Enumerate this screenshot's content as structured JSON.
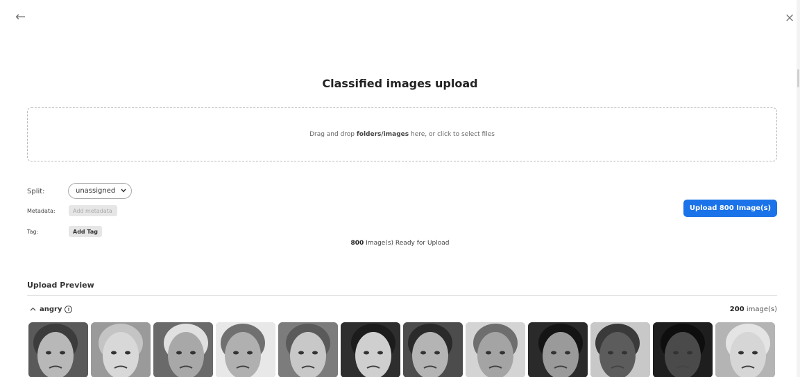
{
  "nav": {
    "back": "←",
    "close": "×"
  },
  "title": "Classified images upload",
  "dropzone": {
    "prefix": "Drag and drop ",
    "bold": "folders/images",
    "suffix": " here, or click to select files"
  },
  "form": {
    "split_label": "Split:",
    "split_value": "unassigned",
    "metadata_label": "Metadata:",
    "metadata_button": "Add metadata",
    "tag_label": "Tag:",
    "tag_button": "Add Tag"
  },
  "upload_button": "Upload 800 Image(s)",
  "ready": {
    "count": "800",
    "text": " Image(s) Ready for Upload"
  },
  "preview": {
    "heading": "Upload Preview",
    "groups": [
      {
        "name": "angry",
        "count": "200",
        "count_suffix": " image(s)"
      }
    ]
  },
  "thumbnails": [
    {
      "bg": "#5a5a5a",
      "face": "#b8b8b8",
      "hair": "#3c3c3c"
    },
    {
      "bg": "#9a9a9a",
      "face": "#d8d8d8",
      "hair": "#c4c4c4"
    },
    {
      "bg": "#6a6a6a",
      "face": "#a8a8a8",
      "hair": "#e0e0e0"
    },
    {
      "bg": "#e8e8e8",
      "face": "#b0b0b0",
      "hair": "#707070"
    },
    {
      "bg": "#7c7c7c",
      "face": "#c8c8c8",
      "hair": "#5a5a5a"
    },
    {
      "bg": "#2e2e2e",
      "face": "#cfcfcf",
      "hair": "#1c1c1c"
    },
    {
      "bg": "#4c4c4c",
      "face": "#b4b4b4",
      "hair": "#2a2a2a"
    },
    {
      "bg": "#d4d4d4",
      "face": "#a4a4a4",
      "hair": "#6e6e6e"
    },
    {
      "bg": "#2a2a2a",
      "face": "#9a9a9a",
      "hair": "#141414"
    },
    {
      "bg": "#c8c8c8",
      "face": "#5c5c5c",
      "hair": "#3a3a3a"
    },
    {
      "bg": "#1e1e1e",
      "face": "#4a4a4a",
      "hair": "#0e0e0e"
    },
    {
      "bg": "#b4b4b4",
      "face": "#d6d6d6",
      "hair": "#e4e4e4"
    }
  ]
}
